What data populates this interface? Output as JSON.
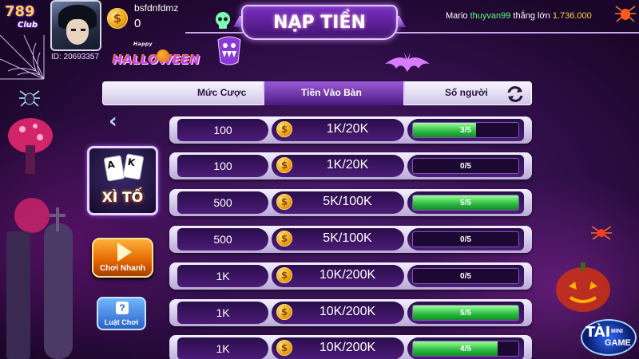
{
  "app": {
    "logo_number": "789",
    "logo_sub": "Club"
  },
  "player": {
    "username": "bsfdnfdmz",
    "balance": "0",
    "id_label": "ID: 20693357"
  },
  "event": {
    "banner": "HALLOWEEN",
    "banner_prefix": "Happy"
  },
  "screen_title": "NẠP TIỀN",
  "winner_feed": {
    "prefix": "Mario",
    "name": "thuyvan99",
    "verb": "thắng lớn",
    "amount": "1.736.000"
  },
  "table_header": {
    "col_bet": "Mức Cược",
    "col_buyin": "Tiền Vào Bàn",
    "col_players": "Số người"
  },
  "game": {
    "name": "XÌ TỐ",
    "card_a": "A",
    "card_k": "K"
  },
  "actions": {
    "quick_play": "Chơi Nhanh",
    "rules": "Luật Chơi",
    "rules_icon": "?"
  },
  "coin_symbol": "$",
  "rooms": [
    {
      "bet": "100",
      "buyin": "1K/20K",
      "players": "3/5",
      "fill": 0.6
    },
    {
      "bet": "100",
      "buyin": "1K/20K",
      "players": "0/5",
      "fill": 0
    },
    {
      "bet": "500",
      "buyin": "5K/100K",
      "players": "5/5",
      "fill": 1
    },
    {
      "bet": "500",
      "buyin": "5K/100K",
      "players": "0/5",
      "fill": 0
    },
    {
      "bet": "1K",
      "buyin": "10K/200K",
      "players": "0/5",
      "fill": 0
    },
    {
      "bet": "1K",
      "buyin": "10K/200K",
      "players": "5/5",
      "fill": 1
    },
    {
      "bet": "1K",
      "buyin": "10K/200K",
      "players": "4/5",
      "fill": 0.8
    }
  ],
  "minigame": {
    "tai": "TÀI",
    "mini": "MINI",
    "game": "GAME"
  },
  "icons": [
    "coin-icon",
    "skull-icon",
    "bat-icon",
    "spider-icon",
    "refresh-icon",
    "back-icon",
    "play-icon",
    "question-icon",
    "spiderweb-icon",
    "pumpkin-icon"
  ],
  "colors": {
    "accent_purple": "#7a2fc2",
    "progress_green": "#2fbf45",
    "gold": "#ffd24a",
    "winner_name": "#5cff7a"
  }
}
